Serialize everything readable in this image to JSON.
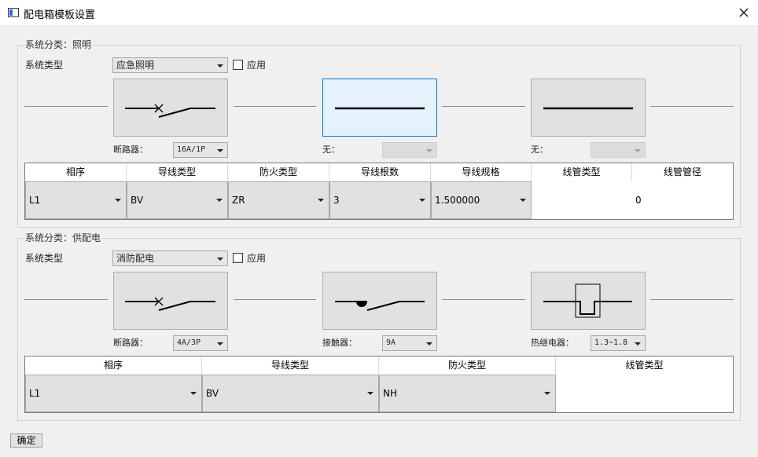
{
  "window": {
    "title": "配电箱模板设置"
  },
  "group1": {
    "title": "系统分类：照明",
    "system_type_label": "系统类型",
    "system_type_value": "应急照明",
    "apply_label": "应用",
    "components": [
      {
        "label": "断路器：",
        "value": "16A/1P",
        "symbol": "breaker"
      },
      {
        "label": "无：",
        "value": "",
        "symbol": "wire"
      },
      {
        "label": "无：",
        "value": "",
        "symbol": "wire"
      }
    ],
    "table": {
      "headers": [
        "相序",
        "导线类型",
        "防火类型",
        "导线根数",
        "导线规格",
        "线管类型",
        "线管管径"
      ],
      "row": [
        "L1",
        "BV",
        "ZR",
        "3",
        "1.500000",
        "",
        "0"
      ]
    }
  },
  "group2": {
    "title": "系统分类：供配电",
    "system_type_label": "系统类型",
    "system_type_value": "消防配电",
    "apply_label": "应用",
    "components": [
      {
        "label": "断路器：",
        "value": "4A/3P",
        "symbol": "breaker"
      },
      {
        "label": "接触器：",
        "value": "9A",
        "symbol": "contactor"
      },
      {
        "label": "热继电器：",
        "value": "1.3~1.8",
        "symbol": "thermal-relay"
      }
    ],
    "table": {
      "headers": [
        "相序",
        "导线类型",
        "防火类型",
        "线管类型"
      ],
      "row": [
        "L1",
        "BV",
        "NH",
        ""
      ]
    }
  },
  "footer": {
    "ok_label": "确定"
  }
}
